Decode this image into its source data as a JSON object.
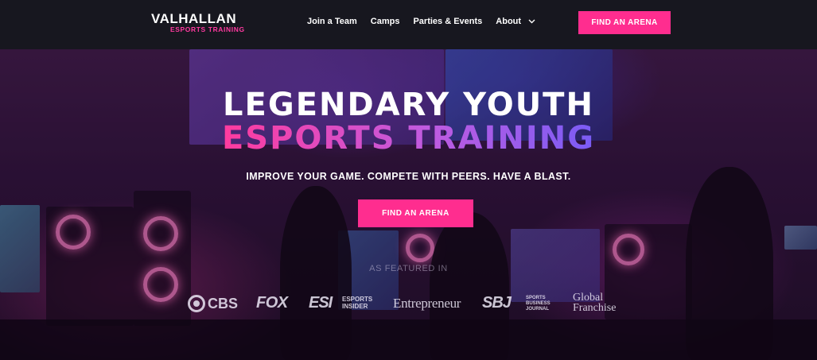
{
  "brand": {
    "name": "VALHALLAN",
    "subtitle": "ESPORTS TRAINING"
  },
  "nav": {
    "links": [
      "Join a Team",
      "Camps",
      "Parties & Events",
      "About"
    ],
    "cta": "FIND AN ARENA"
  },
  "hero": {
    "title_line1": "LEGENDARY YOUTH",
    "title_line2": "ESPORTS TRAINING",
    "tagline": "IMPROVE YOUR GAME. COMPETE WITH PEERS. HAVE A BLAST.",
    "cta": "FIND AN ARENA",
    "featured_label": "AS FEATURED IN"
  },
  "press_logos": {
    "cbs": "CBS",
    "fox": "FOX",
    "esi": "ESI",
    "esi_sub": [
      "ESPORTS",
      "INSIDER"
    ],
    "entrepreneur": "Entrepreneur",
    "sbj": "SBJ",
    "sbj_sub": [
      "SPORTS",
      "BUSINESS",
      "JOURNAL"
    ],
    "global_franchise": [
      "Global",
      "Franchise"
    ]
  },
  "colors": {
    "accent": "#ff2d8f",
    "nav_bg": "#17171f"
  }
}
